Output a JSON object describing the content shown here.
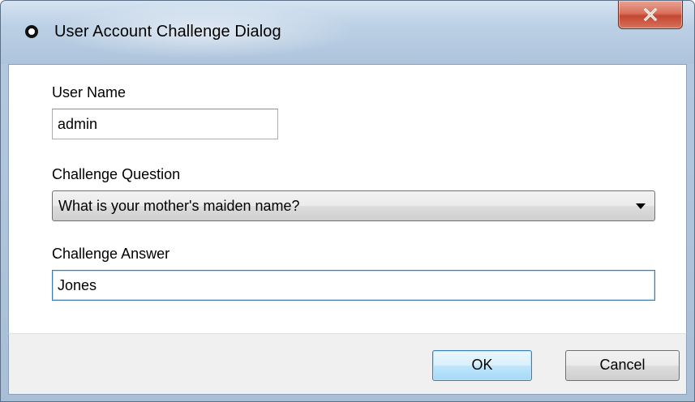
{
  "window": {
    "title": "User Account Challenge Dialog"
  },
  "form": {
    "username_label": "User Name",
    "username_value": "admin",
    "question_label": "Challenge Question",
    "question_selected": "What is your mother's maiden name?",
    "answer_label": "Challenge Answer",
    "answer_value": "Jones"
  },
  "buttons": {
    "ok_label": "OK",
    "cancel_label": "Cancel"
  },
  "icons": {
    "app": "window-app-icon",
    "close": "close-icon",
    "dropdown": "chevron-down-icon"
  },
  "colors": {
    "close_button": "#c44730",
    "default_button_border": "#3c7fb1",
    "focused_input_border": "#3d7bad"
  }
}
